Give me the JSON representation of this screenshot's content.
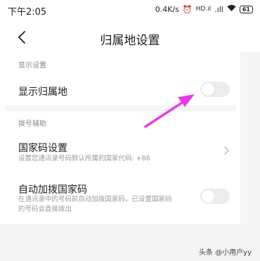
{
  "status_bar": {
    "time": "下午2:05",
    "speed": "0.4K/s",
    "alarm_icon": "alarm-icon",
    "hd_label": "HD",
    "signal_icon": "signal-icon",
    "wifi_icon": "wifi-icon",
    "battery": "61"
  },
  "nav": {
    "back_icon": "back-chevron-icon",
    "title": "归属地设置"
  },
  "display_section": {
    "label": "显示设置",
    "row_title": "显示归属地",
    "toggle_on": false
  },
  "dial_section": {
    "label": "拨号辅助",
    "country_code": {
      "title": "国家码设置",
      "desc": "设置您通讯录号码默认所属的国家代码: +86",
      "chevron_icon": "chevron-right-icon"
    },
    "auto_add": {
      "title": "自动加拨国家码",
      "desc_line1": "在通讯录中的号码前自动加拨国家码，已设置国家码",
      "desc_line2": "的号码会直接拨出",
      "toggle_on": false
    }
  },
  "annotation": {
    "arrow_color": "#e83be8"
  },
  "watermark": "头条 @小用户yy",
  "colors": {
    "toggle_off": "#ececec",
    "section_label": "#8a8a8a",
    "desc_text": "#9a9a9a"
  }
}
